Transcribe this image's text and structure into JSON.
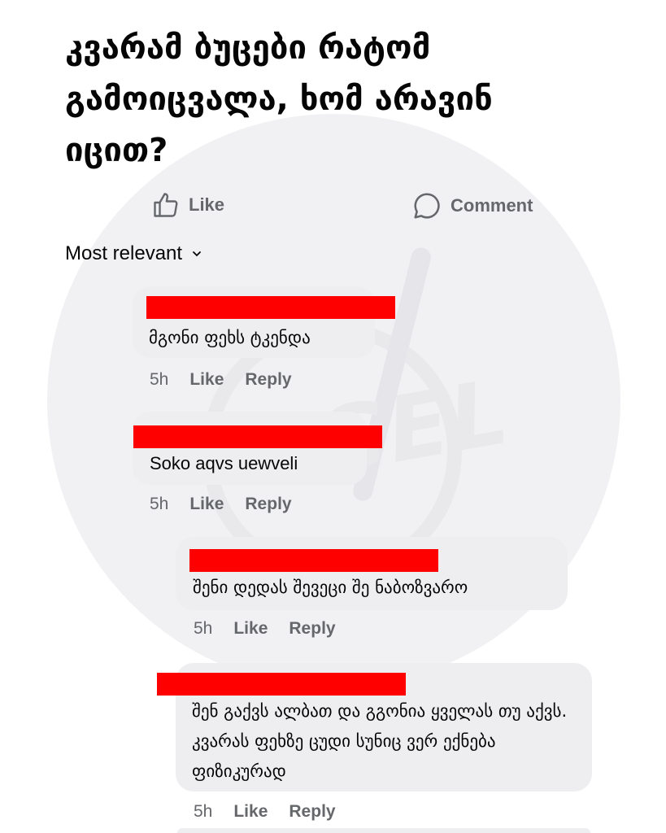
{
  "post": {
    "title": "კვარამ ბუცები რატომ გამოიცვალა, ხომ არავინ იცით?"
  },
  "actions": {
    "like_label": "Like",
    "comment_label": "Comment"
  },
  "sort": {
    "label": "Most relevant"
  },
  "comments": [
    {
      "text": "მგონი ფეხს ტკენდა",
      "time": "5h",
      "like": "Like",
      "reply": "Reply"
    },
    {
      "text": "Soko aqvs uewveli",
      "time": "5h",
      "like": "Like",
      "reply": "Reply"
    },
    {
      "text": "შენი დედას შევეცი შე ნაბოზვარო",
      "time": "5h",
      "like": "Like",
      "reply": "Reply"
    },
    {
      "text": "შენ გაქვს ალბათ და გგონია ყველას თუ აქვს. კვარას ფეხზე ცუდი სუნიც ვერ ექნება ფიზიკურად",
      "time": "5h",
      "like": "Like",
      "reply": "Reply"
    }
  ],
  "colors": {
    "redaction": "#ff0000",
    "bubble": "#eeeef0",
    "muted_text": "#65676b"
  }
}
